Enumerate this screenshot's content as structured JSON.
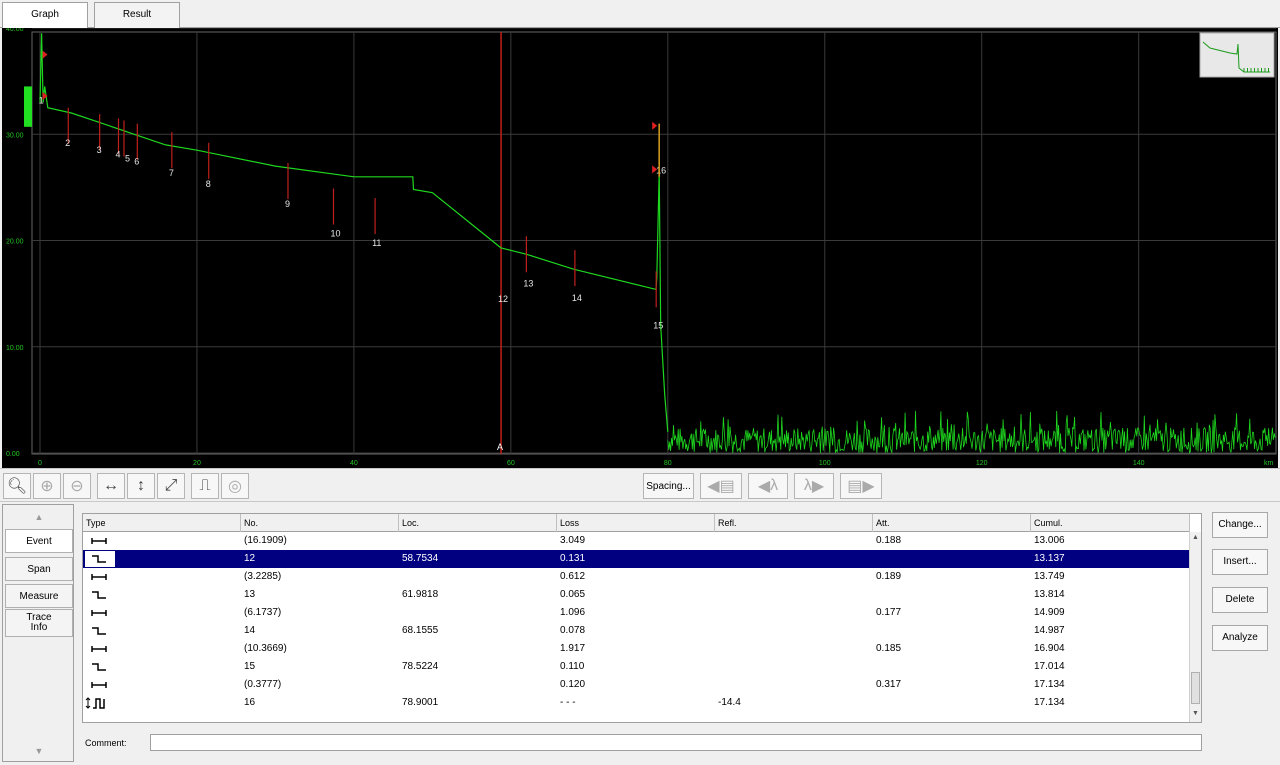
{
  "tabs": [
    {
      "label": "Graph",
      "active": true
    },
    {
      "label": "Result",
      "active": false
    }
  ],
  "graph": {
    "y_ticks": [
      "40.00",
      "30.00",
      "20.00",
      "10.00",
      "0.00"
    ],
    "x_ticks": [
      "0",
      "20",
      "40",
      "60",
      "80",
      "100",
      "120",
      "140",
      "km"
    ],
    "marker_label": "A",
    "event_labels": [
      "1",
      "2",
      "3",
      "4",
      "5",
      "6",
      "7",
      "8",
      "9",
      "10",
      "11",
      "12",
      "13",
      "14",
      "15",
      "16"
    ],
    "colors": {
      "background": "#000000",
      "trace": "#1ed61e",
      "event_marker": "#c0201a",
      "grid": "#3a3a3a",
      "axis_text": "#22c522"
    }
  },
  "chart_data": {
    "type": "line",
    "xlabel": "km",
    "ylabel": "",
    "xlim": [
      0,
      157
    ],
    "ylim": [
      0,
      40
    ],
    "series": [
      {
        "x": [
          0,
          0.2,
          0.4,
          0.6,
          1,
          4,
          8,
          12,
          16,
          20,
          30,
          40,
          47.5,
          47.6,
          50,
          58.75,
          62,
          68,
          78.5,
          78.6,
          78.9,
          79.1,
          79.6,
          80
        ],
        "y": [
          33.0,
          39.5,
          33.0,
          34.5,
          32.5,
          32.0,
          31.0,
          30.0,
          29.0,
          28.5,
          27.0,
          26.0,
          26.0,
          24.8,
          24.5,
          19.3,
          18.7,
          17.3,
          15.4,
          16.5,
          26.5,
          12.0,
          5.5,
          2.0
        ]
      }
    ],
    "events": [
      {
        "no": "1",
        "km": 0.2
      },
      {
        "no": "2",
        "km": 3.6
      },
      {
        "no": "3",
        "km": 7.6
      },
      {
        "no": "4",
        "km": 10.0
      },
      {
        "no": "5",
        "km": 10.7
      },
      {
        "no": "6",
        "km": 12.4
      },
      {
        "no": "7",
        "km": 16.8
      },
      {
        "no": "8",
        "km": 21.5
      },
      {
        "no": "9",
        "km": 31.6
      },
      {
        "no": "10",
        "km": 37.4
      },
      {
        "no": "11",
        "km": 42.7
      },
      {
        "no": "12",
        "km": 58.75
      },
      {
        "no": "13",
        "km": 61.98
      },
      {
        "no": "14",
        "km": 68.16
      },
      {
        "no": "15",
        "km": 78.52
      },
      {
        "no": "16",
        "km": 78.9
      }
    ],
    "cursor_A_km": 58.75
  },
  "toolbar": {
    "spacing_label": "Spacing...",
    "lambda1": "λ",
    "lambda2": "λ"
  },
  "side_tabs": [
    {
      "label": "Event",
      "active": true
    },
    {
      "label": "Span",
      "active": false
    },
    {
      "label": "Measure",
      "active": false
    },
    {
      "label": "Trace Info",
      "active": false
    }
  ],
  "table": {
    "headers": [
      "Type",
      "No.",
      "Loc.",
      "Loss",
      "Refl.",
      "Att.",
      "Cumul."
    ],
    "rows": [
      {
        "type": "span",
        "no": "(16.1909)",
        "loc": "",
        "loss": "3.049",
        "refl": "",
        "att": "0.188",
        "cumul": "13.006",
        "selected": false
      },
      {
        "type": "splice",
        "no": "12",
        "loc": "58.7534",
        "loss": "0.131",
        "refl": "",
        "att": "",
        "cumul": "13.137",
        "selected": true
      },
      {
        "type": "span",
        "no": "(3.2285)",
        "loc": "",
        "loss": "0.612",
        "refl": "",
        "att": "0.189",
        "cumul": "13.749",
        "selected": false
      },
      {
        "type": "splice",
        "no": "13",
        "loc": "61.9818",
        "loss": "0.065",
        "refl": "",
        "att": "",
        "cumul": "13.814",
        "selected": false
      },
      {
        "type": "span",
        "no": "(6.1737)",
        "loc": "",
        "loss": "1.096",
        "refl": "",
        "att": "0.177",
        "cumul": "14.909",
        "selected": false
      },
      {
        "type": "splice",
        "no": "14",
        "loc": "68.1555",
        "loss": "0.078",
        "refl": "",
        "att": "",
        "cumul": "14.987",
        "selected": false
      },
      {
        "type": "span",
        "no": "(10.3669)",
        "loc": "",
        "loss": "1.917",
        "refl": "",
        "att": "0.185",
        "cumul": "16.904",
        "selected": false
      },
      {
        "type": "splice",
        "no": "15",
        "loc": "78.5224",
        "loss": "0.110",
        "refl": "",
        "att": "",
        "cumul": "17.014",
        "selected": false
      },
      {
        "type": "span",
        "no": "(0.3777)",
        "loc": "",
        "loss": "0.120",
        "refl": "",
        "att": "0.317",
        "cumul": "17.134",
        "selected": false
      },
      {
        "type": "end",
        "no": "16",
        "loc": "78.9001",
        "loss": "- - -",
        "refl": "-14.4",
        "att": "",
        "cumul": "17.134",
        "selected": false
      }
    ]
  },
  "actions": {
    "change": "Change...",
    "insert": "Insert...",
    "delete": "Delete",
    "analyze": "Analyze"
  },
  "comment": {
    "label": "Comment:",
    "value": ""
  }
}
